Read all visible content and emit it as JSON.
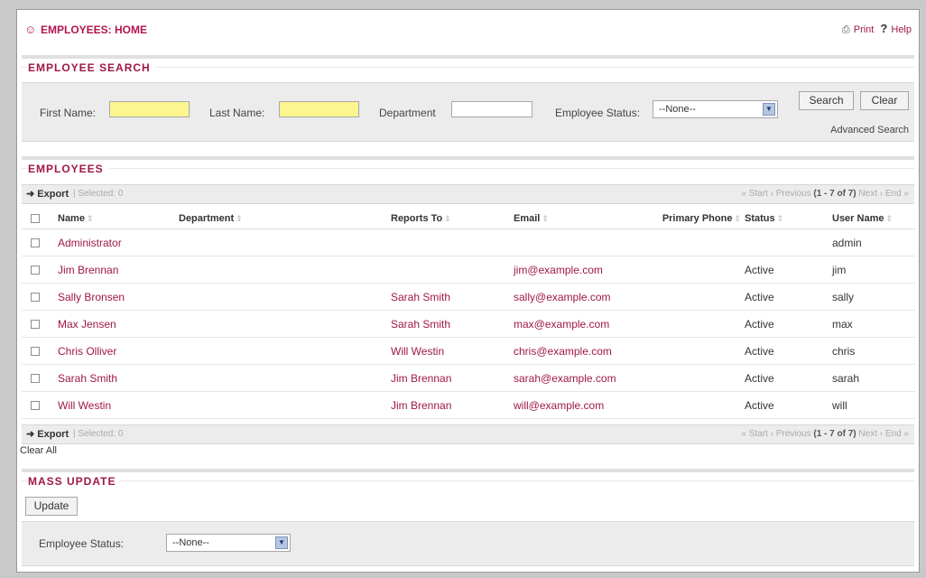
{
  "header": {
    "title": "EMPLOYEES: HOME",
    "print_label": "Print",
    "help_label": "Help"
  },
  "search": {
    "section_title": "EMPLOYEE SEARCH",
    "first_name_label": "First Name:",
    "first_name_value": "",
    "last_name_label": "Last Name:",
    "last_name_value": "",
    "department_label": "Department",
    "department_value": "",
    "status_label": "Employee Status:",
    "status_value": "--None--",
    "search_button": "Search",
    "clear_button": "Clear",
    "advanced_link": "Advanced Search"
  },
  "employees": {
    "section_title": "EMPLOYEES",
    "toolbar": {
      "export_label": "Export",
      "selected_label": "| Selected: 0",
      "start_label": "Start",
      "previous_label": "Previous",
      "range_label": "(1 - 7 of 7)",
      "next_label": "Next",
      "end_label": "End"
    },
    "columns": [
      "Name",
      "Department",
      "Reports To",
      "Email",
      "Primary Phone",
      "Status",
      "User Name"
    ],
    "rows": [
      {
        "name": "Administrator",
        "department": "",
        "reports_to": "",
        "email": "",
        "phone": "",
        "status": "",
        "username": "admin"
      },
      {
        "name": "Jim Brennan",
        "department": "",
        "reports_to": "",
        "email": "jim@example.com",
        "phone": "",
        "status": "Active",
        "username": "jim"
      },
      {
        "name": "Sally Bronsen",
        "department": "",
        "reports_to": "Sarah Smith",
        "email": "sally@example.com",
        "phone": "",
        "status": "Active",
        "username": "sally"
      },
      {
        "name": "Max Jensen",
        "department": "",
        "reports_to": "Sarah Smith",
        "email": "max@example.com",
        "phone": "",
        "status": "Active",
        "username": "max"
      },
      {
        "name": "Chris Olliver",
        "department": "",
        "reports_to": "Will Westin",
        "email": "chris@example.com",
        "phone": "",
        "status": "Active",
        "username": "chris"
      },
      {
        "name": "Sarah Smith",
        "department": "",
        "reports_to": "Jim Brennan",
        "email": "sarah@example.com",
        "phone": "",
        "status": "Active",
        "username": "sarah"
      },
      {
        "name": "Will Westin",
        "department": "",
        "reports_to": "Jim Brennan",
        "email": "will@example.com",
        "phone": "",
        "status": "Active",
        "username": "will"
      }
    ],
    "clear_all_label": "Clear All"
  },
  "mass_update": {
    "section_title": "MASS UPDATE",
    "update_button": "Update",
    "status_label": "Employee Status:",
    "status_value": "--None--"
  },
  "icons": {
    "app": "employees-icon",
    "print": "printer-icon",
    "help": "question-mark-icon",
    "export": "export-arrow-icon",
    "sort": "sort-icon",
    "dropdown": "chevron-down-icon"
  },
  "colors": {
    "accent": "#9e1848",
    "panel": "#ececec",
    "required_field": "#fdf68f"
  }
}
